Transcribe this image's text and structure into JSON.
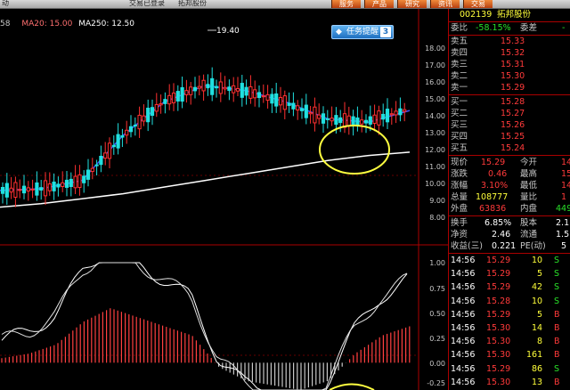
{
  "title_bar": {
    "left_text": "动",
    "center_text": "交易已登录",
    "stock_title": "拓邦股份",
    "menu": [
      "服务",
      "产品",
      "研究",
      "资讯",
      "交易"
    ]
  },
  "ma_line": {
    "prefix": "58",
    "ma20": "MA20: 15.00",
    "ma250": "MA250: 12.50"
  },
  "popup": {
    "label": "任务提醒",
    "count": "3"
  },
  "chart": {
    "peak_label": "19.40",
    "price_axis": [
      "18.00",
      "17.00",
      "16.00",
      "15.00",
      "14.00",
      "13.00",
      "12.00",
      "11.00",
      "10.00",
      "9.00",
      "8.00"
    ],
    "macd_axis": [
      "1.00",
      "0.75",
      "0.50",
      "0.25",
      "0.00",
      "-0.25"
    ]
  },
  "chart_data": [
    {
      "type": "line",
      "title": "",
      "xlabel": "",
      "ylabel": "",
      "ylim": [
        8.0,
        19.5
      ],
      "series": [
        {
          "name": "MA250",
          "values": [
            9.2,
            9.4,
            9.7,
            10.0,
            10.4,
            10.8,
            11.2,
            11.6,
            12.0,
            12.3,
            12.5
          ]
        },
        {
          "name": "MA20",
          "values": [
            10.2,
            10.3,
            10.8,
            13.5,
            15.5,
            16.5,
            16.2,
            15.5,
            14.5,
            14.3,
            15.0
          ]
        }
      ]
    },
    {
      "type": "bar",
      "title": "",
      "ylim": [
        -0.3,
        1.1
      ],
      "values": [
        0.05,
        0.1,
        0.2,
        0.45,
        0.6,
        0.5,
        0.4,
        0.3,
        -0.05,
        -0.2,
        -0.25,
        -0.3,
        -0.2,
        0.1,
        0.3,
        0.4
      ]
    }
  ],
  "quote": {
    "code": "002139",
    "name": "拓邦股份",
    "weibi": {
      "label": "委比",
      "value": "-58.15%",
      "label2": "委差",
      "value2": "-"
    },
    "sells": [
      {
        "label": "卖五",
        "price": "15.33"
      },
      {
        "label": "卖四",
        "price": "15.32"
      },
      {
        "label": "卖三",
        "price": "15.31"
      },
      {
        "label": "卖二",
        "price": "15.30"
      },
      {
        "label": "卖一",
        "price": "15.29"
      }
    ],
    "buys": [
      {
        "label": "买一",
        "price": "15.28"
      },
      {
        "label": "买二",
        "price": "15.27"
      },
      {
        "label": "买三",
        "price": "15.26"
      },
      {
        "label": "买四",
        "price": "15.25"
      },
      {
        "label": "买五",
        "price": "15.24"
      }
    ],
    "stats": [
      {
        "l1": "现价",
        "v1": "15.29",
        "l2": "今开",
        "v2": "14"
      },
      {
        "l1": "涨跌",
        "v1": "0.46",
        "l2": "最高",
        "v2": "15"
      },
      {
        "l1": "涨幅",
        "v1": "3.10%",
        "l2": "最低",
        "v2": "14"
      },
      {
        "l1": "总量",
        "v1": "108777",
        "l2": "量比",
        "v2": "1"
      },
      {
        "l1": "外盘",
        "v1": "63836",
        "l2": "内盘",
        "v2": "449"
      }
    ],
    "stats2": [
      {
        "l1": "换手",
        "v1": "6.85%",
        "l2": "股本",
        "v2": "2.1"
      },
      {
        "l1": "净资",
        "v1": "2.46",
        "l2": "流通",
        "v2": "1.5"
      },
      {
        "l1": "收益(三)",
        "v1": "0.221",
        "l2": "PE(动)",
        "v2": "5"
      }
    ],
    "ticks": [
      {
        "time": "14:56",
        "price": "15.29",
        "vol": "10",
        "bs": "S"
      },
      {
        "time": "14:56",
        "price": "15.29",
        "vol": "5",
        "bs": "S"
      },
      {
        "time": "14:56",
        "price": "15.29",
        "vol": "42",
        "bs": "S"
      },
      {
        "time": "14:56",
        "price": "15.28",
        "vol": "10",
        "bs": "S"
      },
      {
        "time": "14:56",
        "price": "15.29",
        "vol": "5",
        "bs": "B"
      },
      {
        "time": "14:56",
        "price": "15.30",
        "vol": "14",
        "bs": "B"
      },
      {
        "time": "14:56",
        "price": "15.30",
        "vol": "8",
        "bs": "B"
      },
      {
        "time": "14:56",
        "price": "15.30",
        "vol": "161",
        "bs": "B"
      },
      {
        "time": "14:56",
        "price": "15.29",
        "vol": "86",
        "bs": "S"
      },
      {
        "time": "14:56",
        "price": "15.30",
        "vol": "13",
        "bs": "B"
      }
    ]
  }
}
